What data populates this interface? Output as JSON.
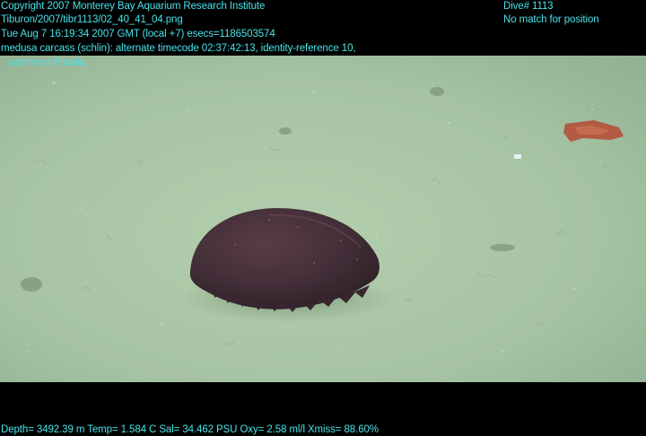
{
  "overlay": {
    "copyright": "Copyright 2007 Monterey Bay Aquarium Research Institute",
    "file_path": "Tiburon/2007/tibr1113/02_40_41_04.png",
    "timestamp": "Tue Aug  7 16:19:34 2007 GMT (local +7)  esecs=1186503574",
    "annotation_line1": "medusa carcass (schlin): alternate timecode 02:37:42:13, identity-reference 10,",
    "annotation_line2": "comment Poralia",
    "dive": "Dive# 1113",
    "position_status": "No match for position",
    "sensors": "Depth= 3492.39 m  Temp= 1.584 C  Sal= 34.462 PSU  Oxy= 2.58 ml/l  Xmiss= 88.60%"
  },
  "colors": {
    "overlay_text": "#49e3ea",
    "seafloor": "#a9c6a6",
    "medusa": "#3f2a33",
    "border": "#000000"
  },
  "image": {
    "subject": "medusa carcass on seafloor",
    "objects": [
      "medusa-bell",
      "red-debris",
      "seafloor-sediment"
    ]
  }
}
